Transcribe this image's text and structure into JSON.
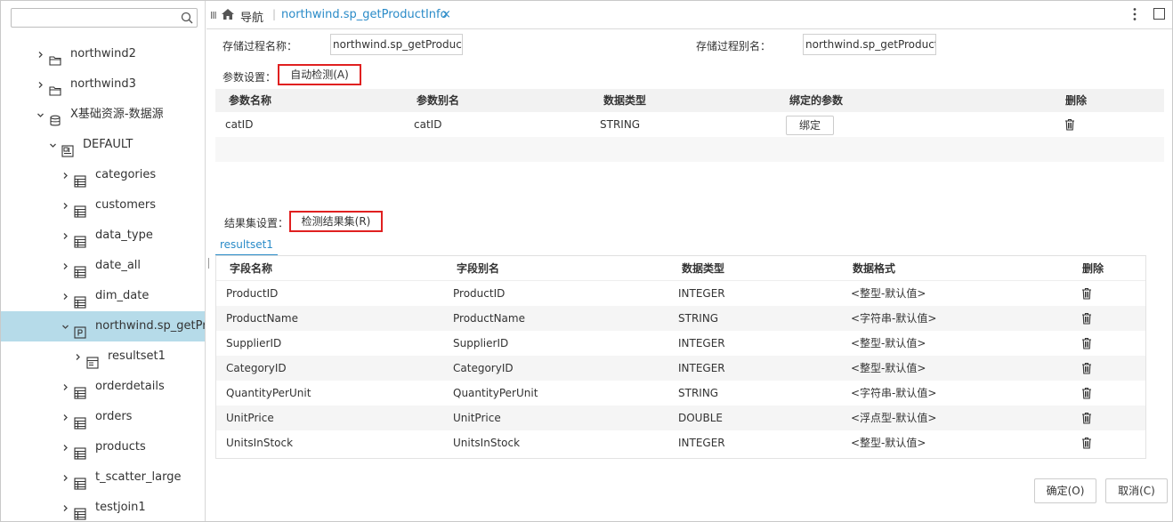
{
  "sidebar": {
    "search_placeholder": "",
    "items": [
      {
        "label": "northwind2",
        "level": 1,
        "icon": "folder-icon",
        "expanded": false,
        "selected": false
      },
      {
        "label": "northwind3",
        "level": 1,
        "icon": "folder-icon",
        "expanded": false,
        "selected": false
      },
      {
        "label": "X基础资源-数据源",
        "level": 1,
        "icon": "database-icon",
        "expanded": true,
        "selected": false
      },
      {
        "label": "DEFAULT",
        "level": 2,
        "icon": "schema-icon",
        "expanded": true,
        "selected": false
      },
      {
        "label": "categories",
        "level": 3,
        "icon": "table-icon",
        "expanded": false,
        "selected": false
      },
      {
        "label": "customers",
        "level": 3,
        "icon": "table-icon",
        "expanded": false,
        "selected": false
      },
      {
        "label": "data_type",
        "level": 3,
        "icon": "table-icon",
        "expanded": false,
        "selected": false
      },
      {
        "label": "date_all",
        "level": 3,
        "icon": "table-icon",
        "expanded": false,
        "selected": false
      },
      {
        "label": "dim_date",
        "level": 3,
        "icon": "table-icon",
        "expanded": false,
        "selected": false
      },
      {
        "label": "northwind.sp_getPr...",
        "level": 3,
        "icon": "procedure-icon",
        "expanded": true,
        "selected": true
      },
      {
        "label": "resultset1",
        "level": 4,
        "icon": "resultset-icon",
        "expanded": false,
        "selected": false
      },
      {
        "label": "orderdetails",
        "level": 3,
        "icon": "table-icon",
        "expanded": false,
        "selected": false
      },
      {
        "label": "orders",
        "level": 3,
        "icon": "table-icon",
        "expanded": false,
        "selected": false
      },
      {
        "label": "products",
        "level": 3,
        "icon": "table-icon",
        "expanded": false,
        "selected": false
      },
      {
        "label": "t_scatter_large",
        "level": 3,
        "icon": "table-icon",
        "expanded": false,
        "selected": false
      },
      {
        "label": "testjoin1",
        "level": 3,
        "icon": "table-icon",
        "expanded": false,
        "selected": false
      }
    ]
  },
  "tabbar": {
    "collapse": "III",
    "nav_label": "导航",
    "separator": "|",
    "active_tab": "northwind.sp_getProductInfo",
    "close": "×"
  },
  "form": {
    "proc_name_label": "存储过程名称：",
    "proc_name_value": "northwind.sp_getProductInf",
    "proc_alias_label": "存储过程别名：",
    "proc_alias_value": "northwind.sp_getProductInf",
    "param_settings_label": "参数设置：",
    "auto_detect_button": "自动检测(A)"
  },
  "params_table": {
    "headers": [
      "参数名称",
      "参数别名",
      "数据类型",
      "绑定的参数",
      "删除"
    ],
    "rows": [
      {
        "name": "catID",
        "alias": "catID",
        "type": "STRING",
        "bind_label": "绑定"
      }
    ]
  },
  "resultset": {
    "settings_label": "结果集设置：",
    "detect_button": "检测结果集(R)",
    "tab_label": "resultset1",
    "headers": [
      "字段名称",
      "字段别名",
      "数据类型",
      "数据格式",
      "删除"
    ],
    "rows": [
      {
        "name": "ProductID",
        "alias": "ProductID",
        "type": "INTEGER",
        "format": "<整型-默认值>"
      },
      {
        "name": "ProductName",
        "alias": "ProductName",
        "type": "STRING",
        "format": "<字符串-默认值>"
      },
      {
        "name": "SupplierID",
        "alias": "SupplierID",
        "type": "INTEGER",
        "format": "<整型-默认值>"
      },
      {
        "name": "CategoryID",
        "alias": "CategoryID",
        "type": "INTEGER",
        "format": "<整型-默认值>"
      },
      {
        "name": "QuantityPerUnit",
        "alias": "QuantityPerUnit",
        "type": "STRING",
        "format": "<字符串-默认值>"
      },
      {
        "name": "UnitPrice",
        "alias": "UnitPrice",
        "type": "DOUBLE",
        "format": "<浮点型-默认值>"
      },
      {
        "name": "UnitsInStock",
        "alias": "UnitsInStock",
        "type": "INTEGER",
        "format": "<整型-默认值>"
      }
    ]
  },
  "footer": {
    "ok_label": "确定(O)",
    "cancel_label": "取消(C)"
  },
  "colors": {
    "accent": "#2a8bc8",
    "selected_row": "#b6dbe9",
    "highlight_border": "#e02020"
  }
}
